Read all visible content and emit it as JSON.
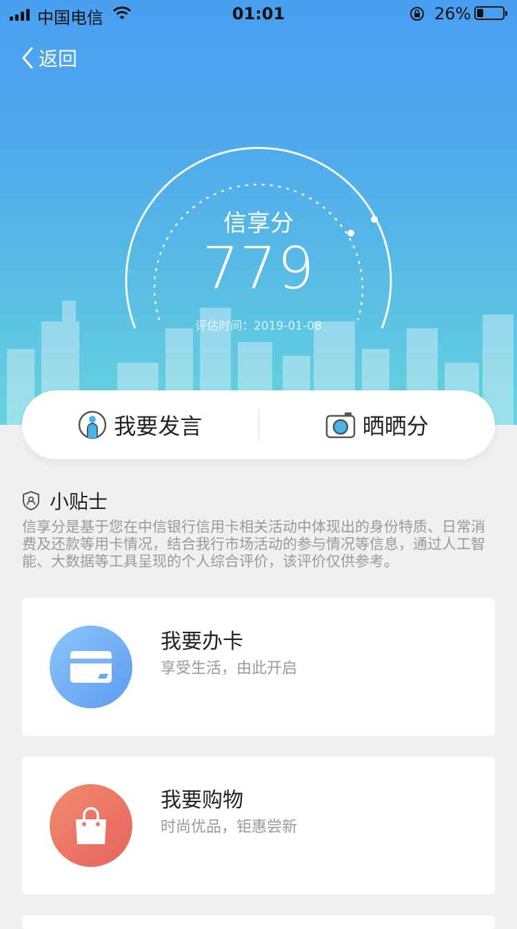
{
  "status_bar": {
    "carrier": "中国电信",
    "time": "01:01",
    "battery_percent": "26%",
    "battery_level": 0.26,
    "icons": [
      "signal-icon",
      "wifi-icon",
      "rotation-lock-icon",
      "battery-icon"
    ]
  },
  "nav": {
    "back_label": "返回",
    "back_icon": "chevron-left-icon"
  },
  "score": {
    "title": "信享分",
    "value": "779",
    "date": "评估时间：2019-01-08"
  },
  "actions": [
    {
      "label": "我要发言",
      "icon": "speaker-person-icon"
    },
    {
      "label": "晒晒分",
      "icon": "camera-icon"
    }
  ],
  "tips": {
    "title": "小贴士",
    "icon": "shield-user-icon",
    "body": "信享分是基于您在中信银行信用卡相关活动中体现出的身份特质、日常消费及还款等用卡情况，结合我行市场活动的参与情况等信息，通过人工智能、大数据等工具呈现的个人综合评价，该评价仅供参考。"
  },
  "cards": [
    {
      "title": "我要办卡",
      "subtitle": "享受生活，由此开启",
      "icon": "credit-card-icon",
      "color_start": "#8ec4f9",
      "color_end": "#5b9cf2"
    },
    {
      "title": "我要购物",
      "subtitle": "时尚优品，钜惠尝新",
      "icon": "shopping-bag-icon",
      "color_start": "#f08b6e",
      "color_end": "#e8625c"
    }
  ],
  "colors": {
    "hero_top": "#4a9ff0",
    "hero_bottom": "#67d3de",
    "background": "#f0f0f0",
    "secondary_text": "#999999"
  }
}
